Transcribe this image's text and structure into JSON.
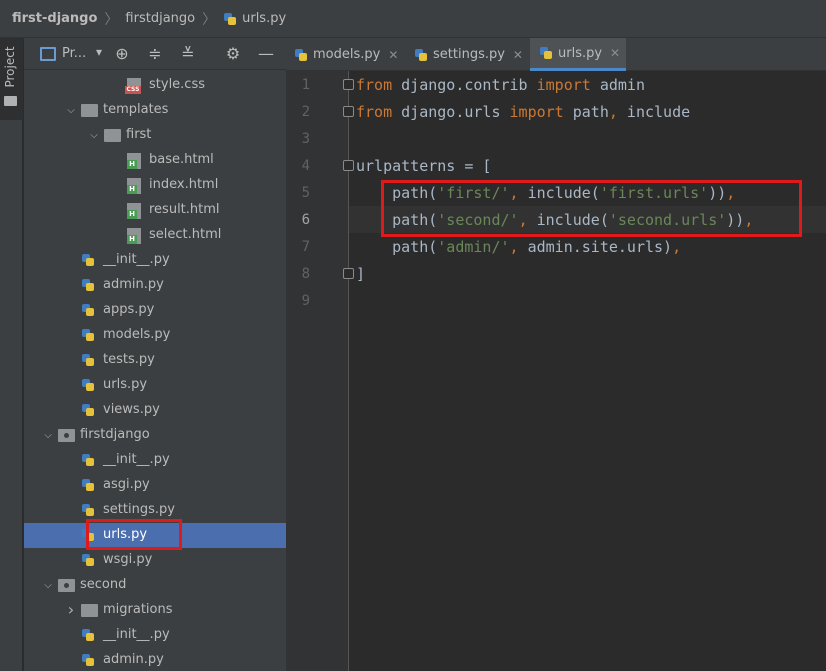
{
  "breadcrumb": [
    "first-django",
    "firstdjango",
    "urls.py"
  ],
  "sidebar": {
    "vertical_tab": "Project",
    "panel_title": "Pr...",
    "tree": [
      {
        "label": "style.css",
        "type": "css",
        "indent": 5
      },
      {
        "label": "templates",
        "type": "folder",
        "indent": 3,
        "expanded": true
      },
      {
        "label": "first",
        "type": "folder",
        "indent": 4,
        "expanded": true
      },
      {
        "label": "base.html",
        "type": "html",
        "indent": 5
      },
      {
        "label": "index.html",
        "type": "html",
        "indent": 5
      },
      {
        "label": "result.html",
        "type": "html",
        "indent": 5
      },
      {
        "label": "select.html",
        "type": "html",
        "indent": 5
      },
      {
        "label": "__init__.py",
        "type": "py",
        "indent": 3
      },
      {
        "label": "admin.py",
        "type": "py",
        "indent": 3
      },
      {
        "label": "apps.py",
        "type": "py",
        "indent": 3
      },
      {
        "label": "models.py",
        "type": "py",
        "indent": 3
      },
      {
        "label": "tests.py",
        "type": "py",
        "indent": 3
      },
      {
        "label": "urls.py",
        "type": "py",
        "indent": 3
      },
      {
        "label": "views.py",
        "type": "py",
        "indent": 3
      },
      {
        "label": "firstdjango",
        "type": "package",
        "indent": 2,
        "expanded": true
      },
      {
        "label": "__init__.py",
        "type": "py",
        "indent": 3
      },
      {
        "label": "asgi.py",
        "type": "py",
        "indent": 3
      },
      {
        "label": "settings.py",
        "type": "py",
        "indent": 3
      },
      {
        "label": "urls.py",
        "type": "py",
        "indent": 3,
        "selected": true
      },
      {
        "label": "wsgi.py",
        "type": "py",
        "indent": 3
      },
      {
        "label": "second",
        "type": "package",
        "indent": 2,
        "expanded": true
      },
      {
        "label": "migrations",
        "type": "folder",
        "indent": 3,
        "expanded": false
      },
      {
        "label": "__init__.py",
        "type": "py",
        "indent": 3
      },
      {
        "label": "admin.py",
        "type": "py",
        "indent": 3
      }
    ]
  },
  "tabs": [
    {
      "label": "models.py",
      "close": "✕"
    },
    {
      "label": "settings.py",
      "close": "✕"
    },
    {
      "label": "urls.py",
      "close": "✕",
      "active": true
    }
  ],
  "editor": {
    "current_line": 6,
    "lines": [
      [
        {
          "t": "from",
          "c": "kw"
        },
        {
          "t": " django.contrib "
        },
        {
          "t": "import",
          "c": "kw"
        },
        {
          "t": " admin"
        }
      ],
      [
        {
          "t": "from",
          "c": "kw"
        },
        {
          "t": " django.urls "
        },
        {
          "t": "import",
          "c": "kw"
        },
        {
          "t": " path"
        },
        {
          "t": ",",
          "c": "kw"
        },
        {
          "t": " include"
        }
      ],
      [],
      [
        {
          "t": "urlpatterns = ["
        }
      ],
      [
        {
          "t": "    path("
        },
        {
          "t": "'first/'",
          "c": "str"
        },
        {
          "t": ",",
          "c": "kw"
        },
        {
          "t": " include("
        },
        {
          "t": "'first.urls'",
          "c": "str"
        },
        {
          "t": "))"
        },
        {
          "t": ",",
          "c": "kw"
        }
      ],
      [
        {
          "t": "    path("
        },
        {
          "t": "'second/'",
          "c": "str"
        },
        {
          "t": ",",
          "c": "kw"
        },
        {
          "t": " include("
        },
        {
          "t": "'second.urls'",
          "c": "str"
        },
        {
          "t": "))"
        },
        {
          "t": ",",
          "c": "kw"
        }
      ],
      [
        {
          "t": "    path("
        },
        {
          "t": "'admin/'",
          "c": "str"
        },
        {
          "t": ",",
          "c": "kw"
        },
        {
          "t": " admin.site.urls)"
        },
        {
          "t": ",",
          "c": "kw"
        }
      ],
      [
        {
          "t": "]"
        }
      ],
      []
    ]
  },
  "colors": {
    "keyword": "#cc7832",
    "string": "#6a8759",
    "selection": "#4b6eaf",
    "highlight_box": "#e01a1a"
  }
}
